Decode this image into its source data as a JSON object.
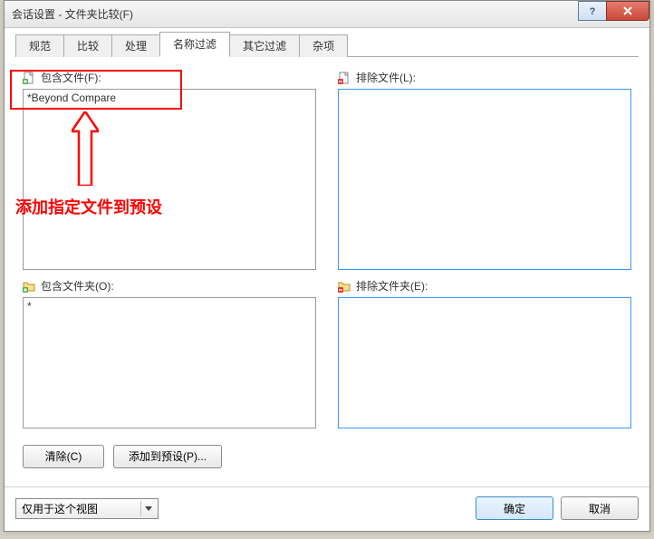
{
  "window": {
    "title": "会话设置 - 文件夹比较(F)"
  },
  "tabs": {
    "items": [
      {
        "label": "规范"
      },
      {
        "label": "比较"
      },
      {
        "label": "处理"
      },
      {
        "label": "名称过滤"
      },
      {
        "label": "其它过滤"
      },
      {
        "label": "杂项"
      }
    ],
    "active_index": 3
  },
  "sections": {
    "include_files_label": "包含文件(F):",
    "include_files_value": "*Beyond Compare",
    "exclude_files_label": "排除文件(L):",
    "exclude_files_value": "",
    "include_folders_label": "包含文件夹(O):",
    "include_folders_value": "*",
    "exclude_folders_label": "排除文件夹(E):",
    "exclude_folders_value": ""
  },
  "buttons": {
    "clear": "清除(C)",
    "add_preset": "添加到预设(P)...",
    "ok": "确定",
    "cancel": "取消"
  },
  "footer": {
    "scope": "仅用于这个视图"
  },
  "annotation": {
    "text": "添加指定文件到预设"
  }
}
